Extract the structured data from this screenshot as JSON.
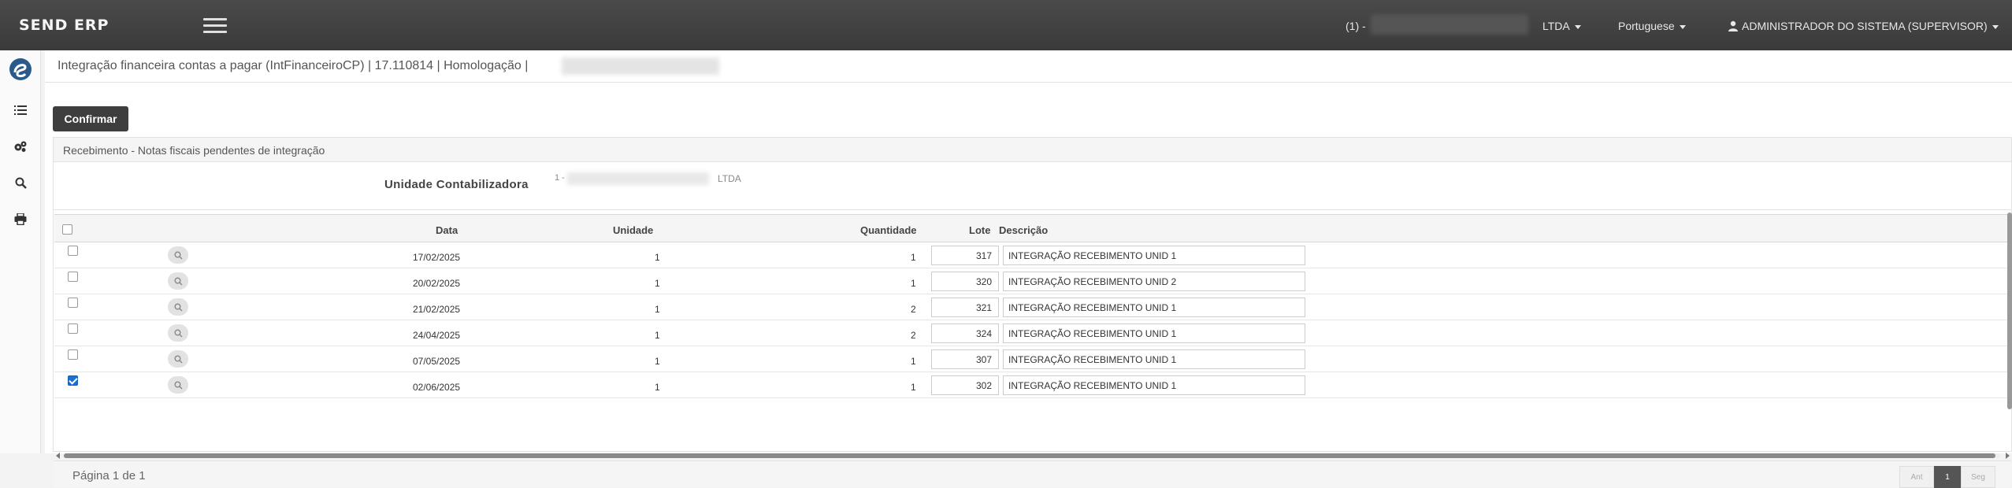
{
  "header": {
    "brand": "SEND ERP",
    "company_code": "(1) -",
    "company_suffix": "LTDA",
    "language": "Portuguese",
    "user": "ADMINISTRADOR DO SISTEMA (SUPERVISOR)"
  },
  "sidebar": {
    "items": [
      {
        "icon": "logo-icon"
      },
      {
        "icon": "list-icon"
      },
      {
        "icon": "gears-icon"
      },
      {
        "icon": "search-icon"
      },
      {
        "icon": "print-icon"
      }
    ]
  },
  "page": {
    "title": "Integração financeira contas a pagar (IntFinanceiroCP) | 17.110814 | Homologação |"
  },
  "toolbar": {
    "confirm_label": "Confirmar"
  },
  "panel": {
    "title": "Recebimento - Notas fiscais pendentes de integração",
    "unit_label": "Unidade Contabilizadora",
    "unit_prefix": "1 -",
    "unit_suffix": "LTDA"
  },
  "grid": {
    "columns": {
      "data": "Data",
      "unidade": "Unidade",
      "quantidade": "Quantidade",
      "lote": "Lote",
      "descricao": "Descrição"
    },
    "rows": [
      {
        "checked": false,
        "data": "17/02/2025",
        "unidade": "1",
        "quantidade": "1",
        "lote": "317",
        "descricao": "INTEGRAÇÃO RECEBIMENTO UNID 1"
      },
      {
        "checked": false,
        "data": "20/02/2025",
        "unidade": "1",
        "quantidade": "1",
        "lote": "320",
        "descricao": "INTEGRAÇÃO RECEBIMENTO UNID 2"
      },
      {
        "checked": false,
        "data": "21/02/2025",
        "unidade": "1",
        "quantidade": "2",
        "lote": "321",
        "descricao": "INTEGRAÇÃO RECEBIMENTO UNID 1"
      },
      {
        "checked": false,
        "data": "24/04/2025",
        "unidade": "1",
        "quantidade": "2",
        "lote": "324",
        "descricao": "INTEGRAÇÃO RECEBIMENTO UNID 1"
      },
      {
        "checked": false,
        "data": "07/05/2025",
        "unidade": "1",
        "quantidade": "1",
        "lote": "307",
        "descricao": "INTEGRAÇÃO RECEBIMENTO UNID 1"
      },
      {
        "checked": true,
        "data": "02/06/2025",
        "unidade": "1",
        "quantidade": "1",
        "lote": "302",
        "descricao": "INTEGRAÇÃO RECEBIMENTO UNID 1"
      }
    ]
  },
  "pager": {
    "text": "Página 1 de 1",
    "prev": "Ant",
    "current": "1",
    "next": "Seg"
  },
  "colors": {
    "topbar": "#3f3f3f",
    "button": "#3e3e3e",
    "checkbox_checked": "#1a6fd0"
  }
}
